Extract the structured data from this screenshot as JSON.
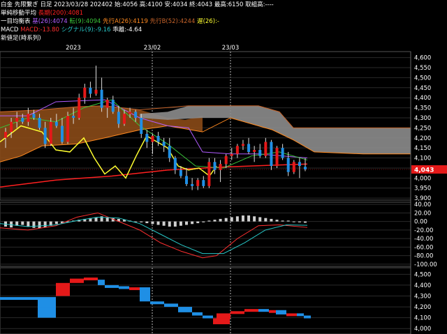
{
  "header": {
    "symbol": "白金",
    "contract": "先限繋ぎ",
    "period": "日足",
    "date": "2023/03/28",
    "contract_month": "202402",
    "open_label": "始:",
    "open": "4056",
    "high_label": "高:",
    "high": "4100",
    "low_label": "安:",
    "low": "4034",
    "close_label": "終:",
    "close": "4043",
    "alltime_high_label": "最高:",
    "alltime_high": "6150",
    "volume_label": "取組高:",
    "volume": "----"
  },
  "indicators": {
    "sma": {
      "title": "単純移動平均",
      "value_text": "長期(200):4081",
      "color": "#ff2020"
    },
    "ichimoku": {
      "title": "一目均衡表",
      "base_text": "基(26):4074",
      "base_color": "#b05cff",
      "conv_text": "転(9):4094",
      "conv_color": "#39c239",
      "spanA_text": "先行A(26):4119",
      "spanA_color": "#ff8a20",
      "spanB_text": "先行B(52):4244",
      "spanB_color": "#c8642a",
      "lag_text": "遅(26):-",
      "lag_color": "#ffff30"
    },
    "macd": {
      "title": "MACD",
      "macd_text": "MACD:-13.80",
      "macd_color": "#ff3030",
      "signal_text": "シグナル(9):-9.16",
      "signal_color": "#27c7c7",
      "hist_text": "乖離:-4.64"
    },
    "kagi": {
      "title": "新値足(時系列)"
    }
  },
  "date_axis": [
    "2023",
    "23/02",
    "23/03"
  ],
  "price_axis": [
    "4,600",
    "4,550",
    "4,500",
    "4,450",
    "4,400",
    "4,350",
    "4,300",
    "4,250",
    "4,200",
    "4,150",
    "4,100",
    "4,050",
    "4,000",
    "3,950",
    "3,900"
  ],
  "macd_axis": [
    "40.00",
    "20.00",
    "0.00",
    "-20.00",
    "-40.00",
    "-60.00",
    "-80.00",
    "-100.00"
  ],
  "kagi_axis": [
    "4,500",
    "4,400",
    "4,300",
    "4,200",
    "4,100",
    "4,000"
  ],
  "current_price_badge": "4,043",
  "colors": {
    "up": "#e51919",
    "down": "#1f8fe5",
    "cloud_bull": "#8a4a17",
    "cloud_bear": "#8c8c8c"
  },
  "chart_data": {
    "type": "candlestick",
    "series": [
      {
        "name": "ohlc",
        "values": [
          [
            4200,
            4250,
            4150,
            4230
          ],
          [
            4230,
            4300,
            4200,
            4280
          ],
          [
            4280,
            4330,
            4250,
            4300
          ],
          [
            4300,
            4320,
            4270,
            4280
          ],
          [
            4280,
            4350,
            4260,
            4320
          ],
          [
            4320,
            4340,
            4290,
            4300
          ],
          [
            4300,
            4320,
            4240,
            4250
          ],
          [
            4250,
            4280,
            4150,
            4170
          ],
          [
            4170,
            4300,
            4160,
            4280
          ],
          [
            4280,
            4320,
            4250,
            4260
          ],
          [
            4260,
            4300,
            4170,
            4180
          ],
          [
            4180,
            4330,
            4170,
            4310
          ],
          [
            4310,
            4350,
            4270,
            4300
          ],
          [
            4300,
            4420,
            4290,
            4400
          ],
          [
            4400,
            4470,
            4370,
            4450
          ],
          [
            4450,
            4480,
            4400,
            4420
          ],
          [
            4420,
            4560,
            4410,
            4440
          ],
          [
            4440,
            4500,
            4330,
            4350
          ],
          [
            4350,
            4400,
            4300,
            4390
          ],
          [
            4390,
            4410,
            4320,
            4330
          ],
          [
            4330,
            4360,
            4250,
            4270
          ],
          [
            4270,
            4340,
            4260,
            4320
          ],
          [
            4320,
            4350,
            4300,
            4330
          ],
          [
            4330,
            4340,
            4280,
            4300
          ],
          [
            4300,
            4320,
            4200,
            4220
          ],
          [
            4220,
            4240,
            4150,
            4180
          ],
          [
            4180,
            4220,
            4120,
            4210
          ],
          [
            4210,
            4230,
            4160,
            4180
          ],
          [
            4180,
            4200,
            4130,
            4160
          ],
          [
            4160,
            4200,
            4080,
            4100
          ],
          [
            4100,
            4110,
            4020,
            4040
          ],
          [
            4040,
            4060,
            4000,
            4010
          ],
          [
            4010,
            4050,
            3960,
            3970
          ],
          [
            3970,
            4000,
            3940,
            3960
          ],
          [
            3960,
            4000,
            3940,
            3990
          ],
          [
            3990,
            4010,
            3950,
            3960
          ],
          [
            3960,
            4100,
            3950,
            4080
          ],
          [
            4080,
            4100,
            4020,
            4040
          ],
          [
            4040,
            4090,
            3980,
            4070
          ],
          [
            4070,
            4120,
            4050,
            4110
          ],
          [
            4110,
            4150,
            4090,
            4120
          ],
          [
            4120,
            4170,
            4100,
            4160
          ],
          [
            4160,
            4190,
            4140,
            4170
          ],
          [
            4170,
            4200,
            4120,
            4130
          ],
          [
            4130,
            4160,
            4080,
            4140
          ],
          [
            4140,
            4170,
            4100,
            4110
          ],
          [
            4110,
            4200,
            4100,
            4180
          ],
          [
            4180,
            4190,
            4040,
            4060
          ],
          [
            4060,
            4160,
            4050,
            4150
          ],
          [
            4150,
            4170,
            4090,
            4100
          ],
          [
            4100,
            4130,
            4010,
            4030
          ],
          [
            4030,
            4090,
            4020,
            4080
          ],
          [
            4080,
            4100,
            4000,
            4060
          ],
          [
            4056,
            4100,
            4034,
            4043
          ]
        ]
      }
    ],
    "x_range": [
      "2022/12",
      "2023/03/28"
    ],
    "ylim": [
      3890,
      4630
    ],
    "macd_ylim": [
      -105,
      45
    ],
    "kagi_ylim": [
      3950,
      4560
    ]
  }
}
